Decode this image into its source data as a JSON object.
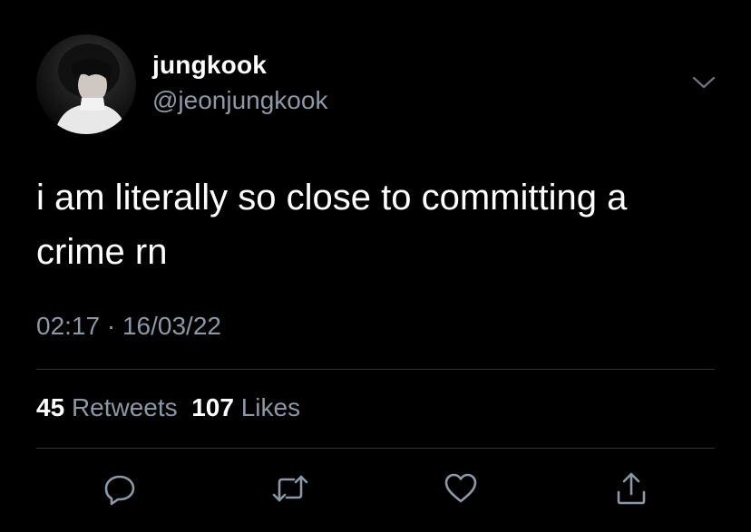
{
  "tweet": {
    "display_name": "jungkook",
    "handle": "@jeonjungkook",
    "text": "i am literally so close to committing a crime rn",
    "time": "02:17",
    "separator": " · ",
    "date": "16/03/22",
    "retweets_count": "45",
    "retweets_label": "Retweets",
    "likes_count": "107",
    "likes_label": "Likes"
  },
  "actions": {
    "reply_icon": "reply-icon",
    "retweet_icon": "retweet-icon",
    "like_icon": "heart-icon",
    "share_icon": "share-icon"
  },
  "colors": {
    "background": "#000000",
    "primary_text": "#ffffff",
    "secondary_text": "#8b98a5",
    "divider": "#2f3336"
  }
}
